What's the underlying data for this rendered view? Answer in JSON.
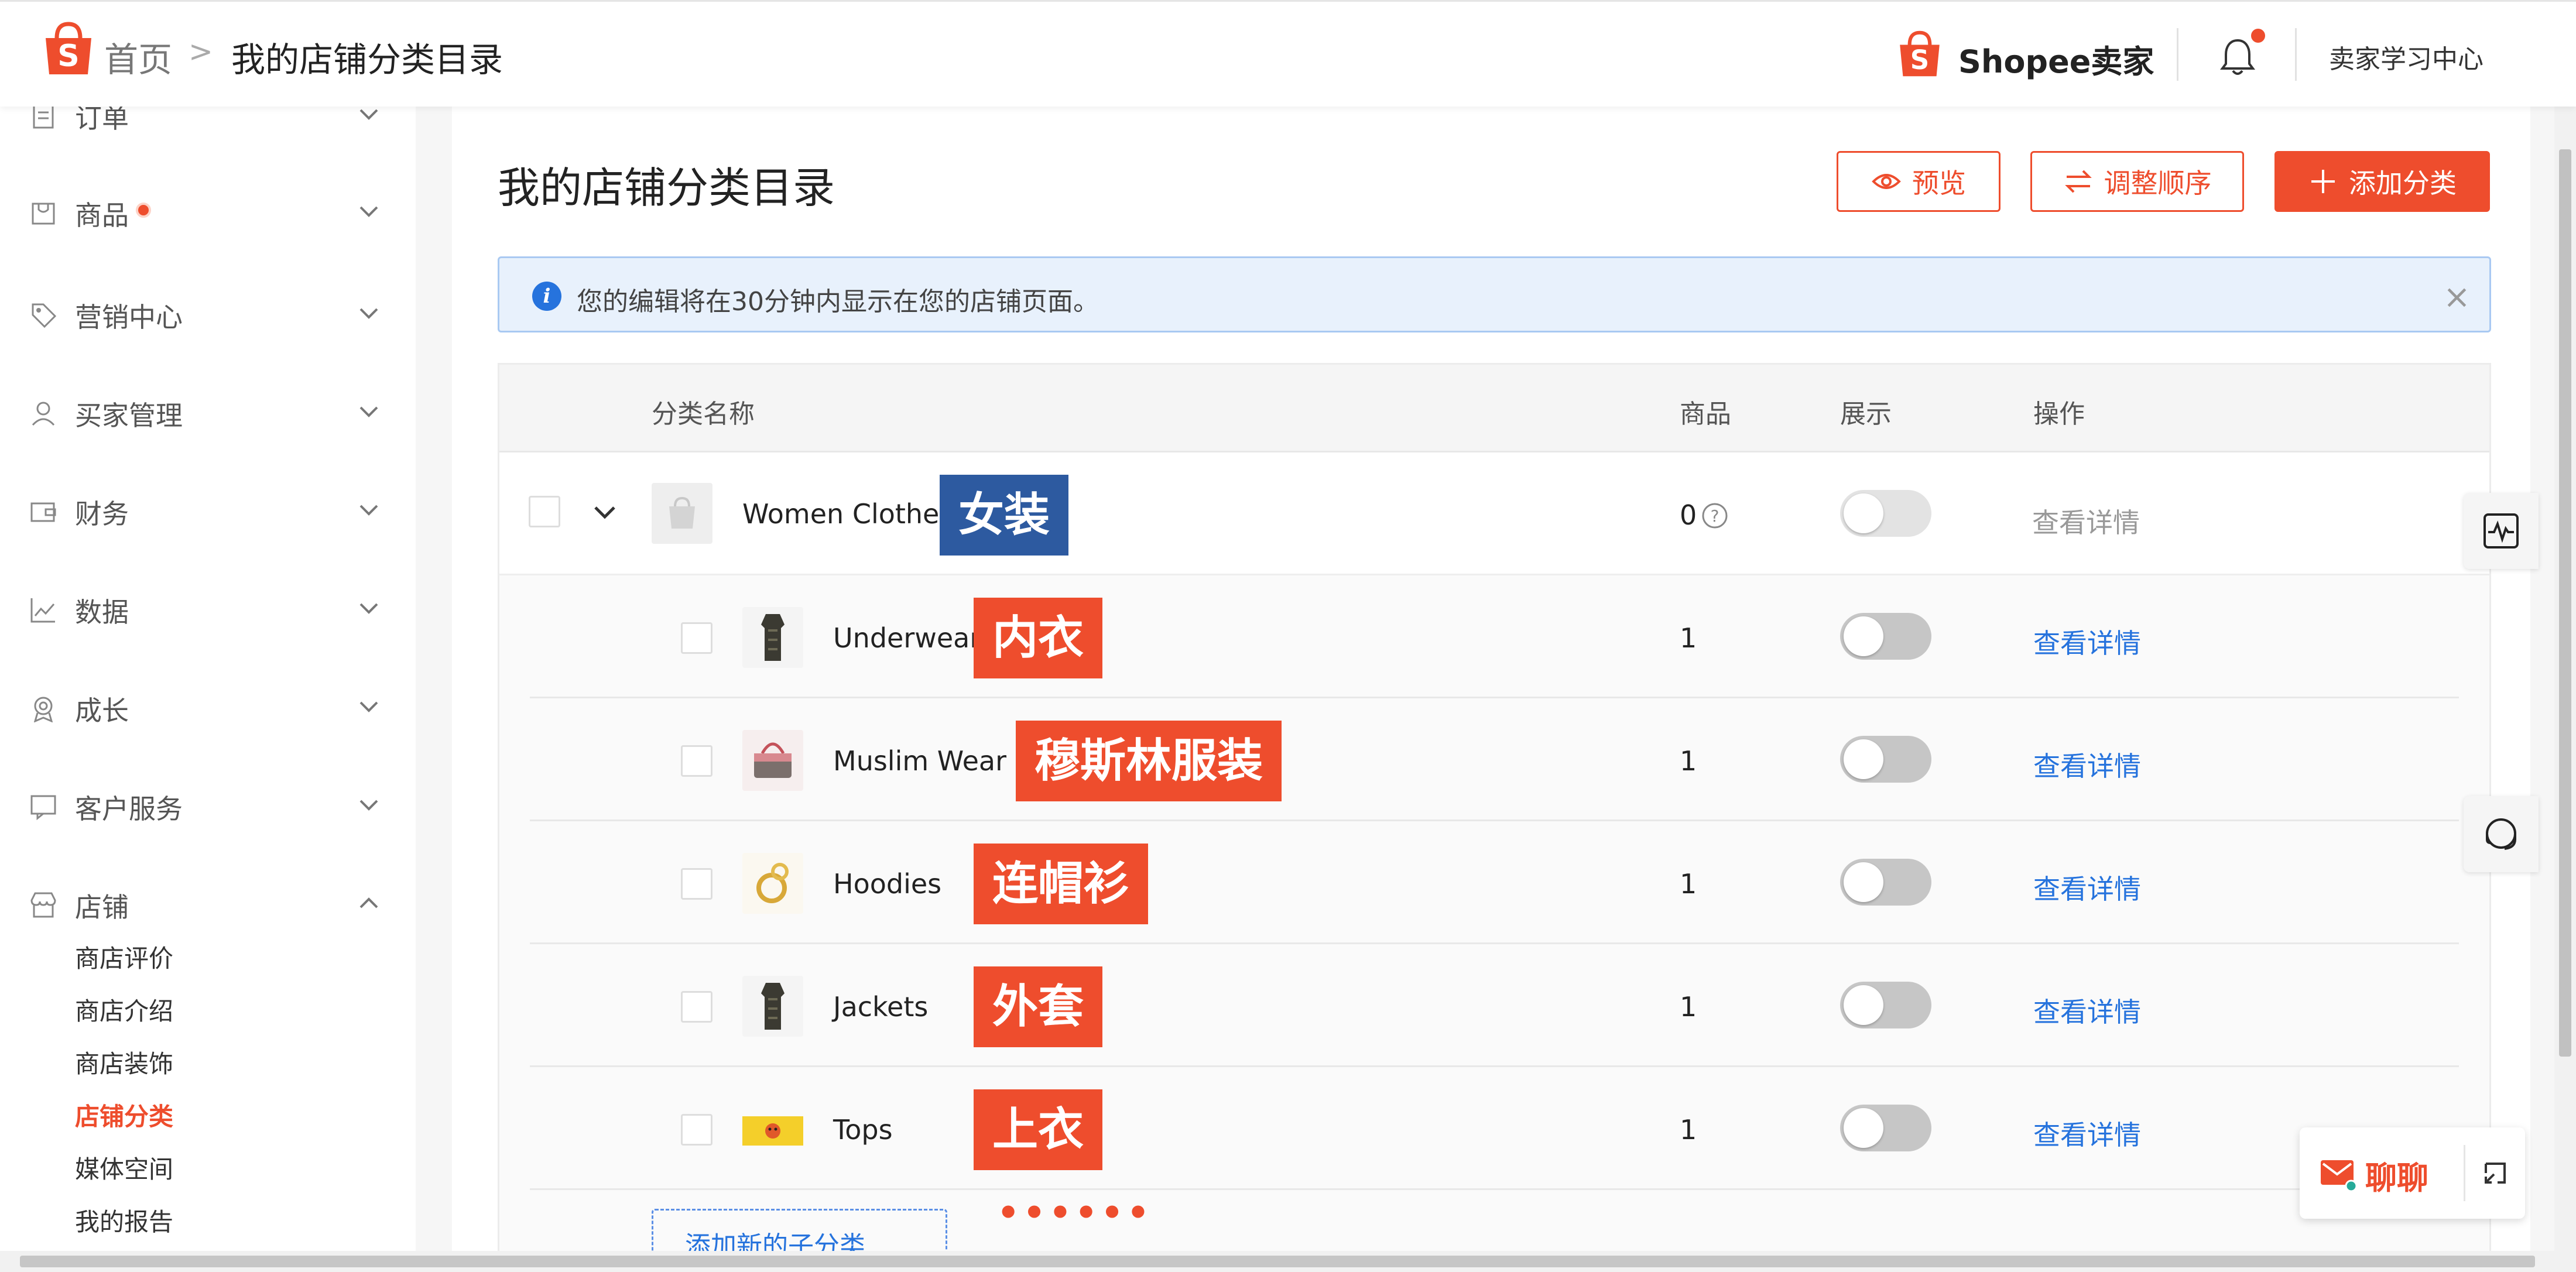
{
  "header": {
    "breadcrumb_home": "首页",
    "breadcrumb_sep": ">",
    "breadcrumb_current": "我的店铺分类目录",
    "seller_brand": "Shopee卖家",
    "learning_center": "卖家学习中心"
  },
  "sidebar": {
    "items": [
      {
        "label": "订单"
      },
      {
        "label": "商品"
      },
      {
        "label": "营销中心"
      },
      {
        "label": "买家管理"
      },
      {
        "label": "财务"
      },
      {
        "label": "数据"
      },
      {
        "label": "成长"
      },
      {
        "label": "客户服务"
      },
      {
        "label": "店铺"
      }
    ],
    "shop_sub": [
      "商店评价",
      "商店介绍",
      "商店装饰",
      "店铺分类",
      "媒体空间",
      "我的报告"
    ]
  },
  "main": {
    "title": "我的店铺分类目录",
    "buttons": {
      "preview": "预览",
      "reorder": "调整顺序",
      "add": "添加分类"
    },
    "notice": "您的编辑将在30分钟内显示在您的店铺页面。",
    "table": {
      "headers": {
        "name": "分类名称",
        "products": "商品",
        "display": "展示",
        "actions": "操作"
      },
      "parent": {
        "name": "Women Clothes",
        "tag": "女装",
        "count": "0",
        "action": "查看详情"
      },
      "children": [
        {
          "name": "Underwear",
          "tag": "内衣",
          "count": "1",
          "action": "查看详情"
        },
        {
          "name": "Muslim Wear",
          "tag": "穆斯林服装",
          "count": "1",
          "action": "查看详情"
        },
        {
          "name": "Hoodies",
          "tag": "连帽衫",
          "count": "1",
          "action": "查看详情"
        },
        {
          "name": "Jackets",
          "tag": "外套",
          "count": "1",
          "action": "查看详情"
        },
        {
          "name": "Tops",
          "tag": "上衣",
          "count": "1",
          "action": "查看详情"
        }
      ],
      "add_sub": "添加新的子分类",
      "dots": "••••••"
    }
  },
  "chat": {
    "label": "聊聊"
  },
  "colors": {
    "brand": "#ee4d2d",
    "link": "#2673dd",
    "tag_blue": "#2d5aa0"
  }
}
